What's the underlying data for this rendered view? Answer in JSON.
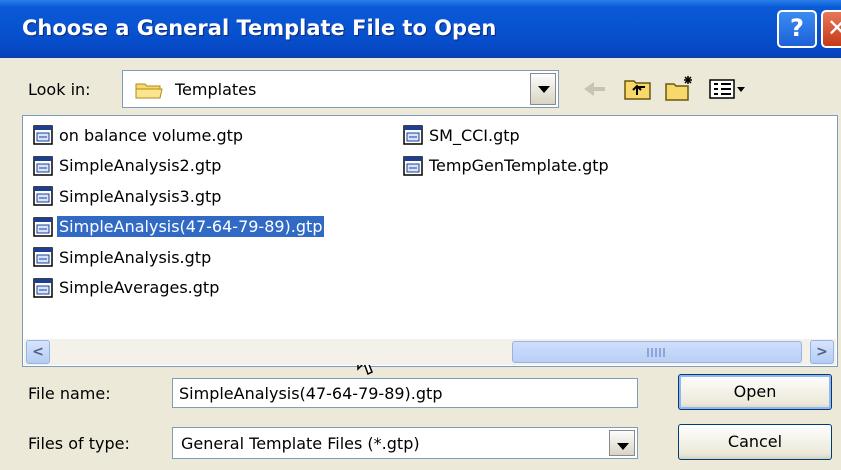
{
  "window": {
    "title": "Choose a General Template File to Open",
    "help_glyph": "?",
    "close_glyph": "✕"
  },
  "look_in": {
    "label": "Look in:",
    "value": "Templates"
  },
  "toolbar": {
    "icons": [
      "back-arrow-icon",
      "up-folder-icon",
      "new-folder-icon",
      "view-menu-icon"
    ]
  },
  "files": {
    "column1": [
      "on balance volume.gtp",
      "SimpleAnalysis2.gtp",
      "SimpleAnalysis3.gtp",
      "SimpleAnalysis(47-64-79-89).gtp",
      "SimpleAnalysis.gtp",
      "SimpleAverages.gtp"
    ],
    "column2": [
      "SM_CCI.gtp",
      "TempGenTemplate.gtp"
    ],
    "selected": "SimpleAnalysis(47-64-79-89).gtp"
  },
  "scroll": {
    "left_glyph": "<",
    "right_glyph": ">"
  },
  "file_name": {
    "label": "File name:",
    "value": "SimpleAnalysis(47-64-79-89).gtp"
  },
  "file_type": {
    "label": "Files of type:",
    "value": "General Template Files (*.gtp)"
  },
  "buttons": {
    "open": "Open",
    "cancel": "Cancel"
  },
  "colors": {
    "title_bar": "#0852d0",
    "selection": "#316ac5",
    "dialog_bg": "#ece9d8"
  }
}
